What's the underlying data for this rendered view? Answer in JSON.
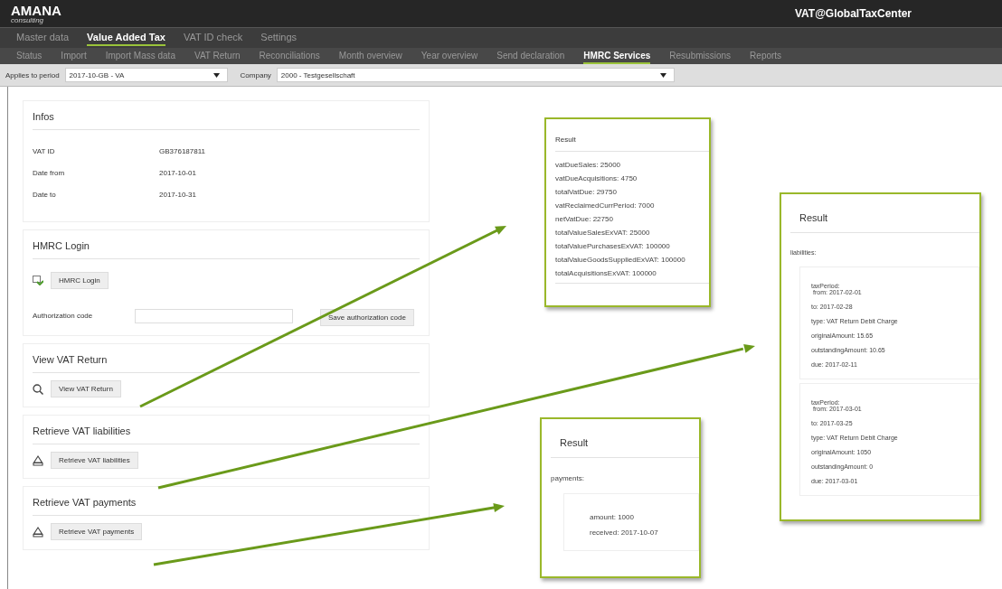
{
  "header": {
    "logo": "AMANA",
    "logo_sub": "consulting",
    "app_title": "VAT@GlobalTaxCenter"
  },
  "main_tabs": [
    {
      "label": "Master data",
      "selected": false
    },
    {
      "label": "Value Added Tax",
      "selected": true
    },
    {
      "label": "VAT ID check",
      "selected": false
    },
    {
      "label": "Settings",
      "selected": false
    }
  ],
  "sub_tabs": [
    {
      "label": "Status",
      "selected": false
    },
    {
      "label": "Import",
      "selected": false
    },
    {
      "label": "Import Mass data",
      "selected": false
    },
    {
      "label": "VAT Return",
      "selected": false
    },
    {
      "label": "Reconciliations",
      "selected": false
    },
    {
      "label": "Month overview",
      "selected": false
    },
    {
      "label": "Year overview",
      "selected": false
    },
    {
      "label": "Send declaration",
      "selected": false
    },
    {
      "label": "HMRC Services",
      "selected": true
    },
    {
      "label": "Resubmissions",
      "selected": false
    },
    {
      "label": "Reports",
      "selected": false
    }
  ],
  "filters": {
    "period_label": "Applies to period",
    "period_value": "2017-10-GB - VA",
    "company_label": "Company",
    "company_value": "2000 - Testgesellschaft"
  },
  "sections": [
    {
      "kind": "info",
      "title": "Infos",
      "rows": [
        {
          "label": "VAT ID",
          "value": "GB376187811"
        },
        {
          "label": "Date from",
          "value": "2017-10-01"
        },
        {
          "label": "Date to",
          "value": "2017-10-31"
        }
      ]
    },
    {
      "kind": "login",
      "title": "HMRC Login",
      "button": "HMRC Login",
      "code_label": "Authorization code",
      "save_button": "Save authorization code"
    },
    {
      "kind": "view",
      "title": "View VAT Return",
      "button": "View VAT Return"
    },
    {
      "kind": "retrieve",
      "title": "Retrieve VAT liabilities",
      "button": "Retrieve VAT liabilities"
    },
    {
      "kind": "retrieve",
      "title": "Retrieve VAT payments",
      "button": "Retrieve VAT payments"
    }
  ],
  "results": [
    {
      "kind": "list",
      "title": "Result",
      "lines": [
        "vatDueSales: 25000",
        "vatDueAcquisitions: 4750",
        "totalVatDue: 29750",
        "vatReclaimedCurrPeriod: 7000",
        "netVatDue: 22750",
        "totalValueSalesExVAT: 25000",
        "totalValuePurchasesExVAT: 100000",
        "totalValueGoodsSuppliedExVAT: 100000",
        "totalAcquisitionsExVAT: 100000"
      ]
    },
    {
      "kind": "groups",
      "title": "Result",
      "heading": "liabilities:",
      "groups": [
        {
          "period_label": "taxPeriod:",
          "period_from": "from: 2017-02-01",
          "lines": [
            "to: 2017-02-28",
            "type: VAT Return Debit Charge",
            "originalAmount: 15.65",
            "outstandingAmount: 10.65",
            "due: 2017-02-11"
          ]
        },
        {
          "period_label": "taxPeriod:",
          "period_from": "from: 2017-03-01",
          "lines": [
            "to: 2017-03-25",
            "type: VAT Return Debit Charge",
            "originalAmount: 1050",
            "outstandingAmount: 0",
            "due: 2017-03-01"
          ]
        }
      ]
    },
    {
      "kind": "groups",
      "title": "Result",
      "heading": "payments:",
      "groups": [
        {
          "lines": [
            "amount: 1000",
            "received: 2017-10-07"
          ]
        }
      ]
    }
  ]
}
